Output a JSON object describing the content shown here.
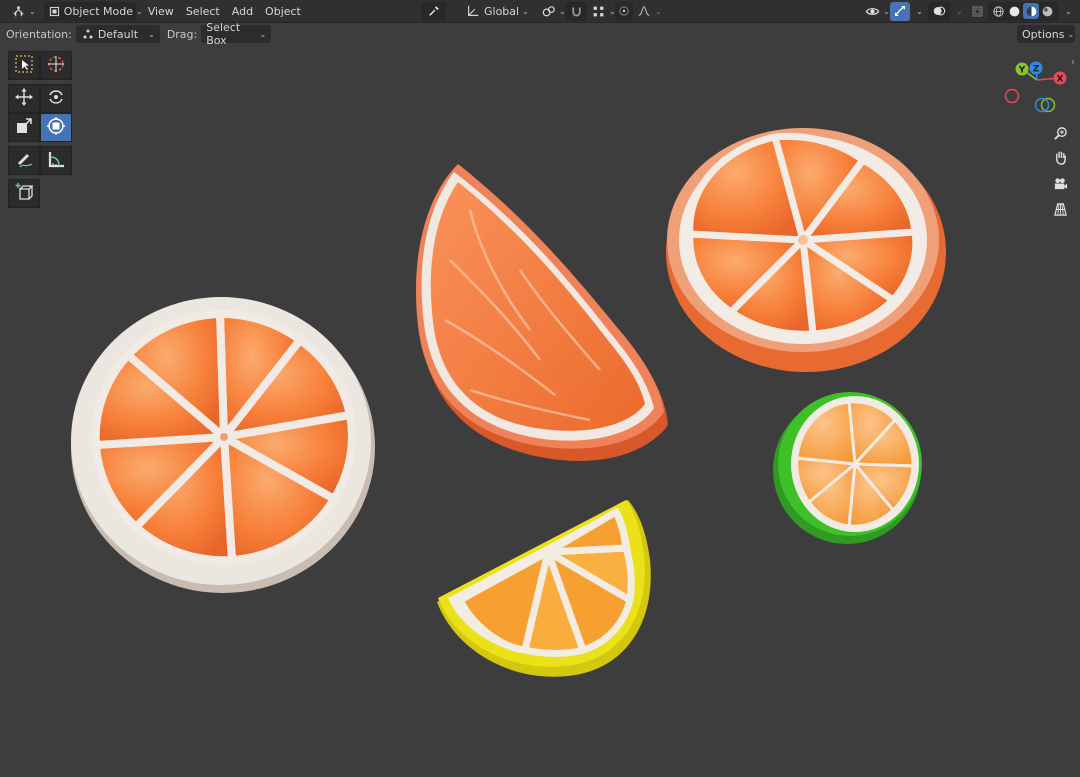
{
  "header": {
    "editor_type_icon": "editor-type-3d-viewport-icon",
    "mode_label": "Object Mode",
    "menus": [
      "View",
      "Select",
      "Add",
      "Object"
    ],
    "orientation_label": "Global",
    "accent_color": "#4772b3"
  },
  "tool_settings": {
    "orientation_label": "Orientation:",
    "orientation_value": "Default",
    "drag_label": "Drag:",
    "drag_value": "Select Box",
    "options_label": "Options"
  },
  "toolbar": {
    "tools": [
      {
        "name": "select-box-tool",
        "icon": "select-box-icon",
        "active": false
      },
      {
        "name": "cursor-tool",
        "icon": "cursor-icon",
        "active": false
      },
      {
        "name": "move-tool",
        "icon": "move-icon",
        "active": false
      },
      {
        "name": "rotate-tool",
        "icon": "rotate-icon",
        "active": false
      },
      {
        "name": "scale-tool",
        "icon": "scale-icon",
        "active": false
      },
      {
        "name": "transform-tool",
        "icon": "transform-icon",
        "active": true
      },
      {
        "name": "annotate-tool",
        "icon": "annotate-icon",
        "active": false
      },
      {
        "name": "measure-tool",
        "icon": "measure-icon",
        "active": false
      },
      {
        "name": "add-cube-tool",
        "icon": "add-cube-icon",
        "active": false
      }
    ]
  },
  "gizmo": {
    "axis_x": "X",
    "axis_y": "Y",
    "axis_z": "Z",
    "colors": {
      "x": "#e8495c",
      "y": "#8ac42a",
      "z": "#2f8ae8"
    }
  },
  "viewport": {
    "background": "#3d3d3d",
    "objects": [
      {
        "name": "orange-slice-large",
        "rind": "#e9e4df",
        "flesh": "#f7803a"
      },
      {
        "name": "orange-wedge",
        "rind": "#f0825a",
        "flesh": "#f7823c"
      },
      {
        "name": "orange-half",
        "rind": "#f0a079",
        "flesh": "#f7803a"
      },
      {
        "name": "lemon-wedge",
        "rind": "#e8dd18",
        "flesh": "#f7a032"
      },
      {
        "name": "lime-slice",
        "rind": "#3ec029",
        "flesh": "#f49a3e"
      }
    ]
  }
}
